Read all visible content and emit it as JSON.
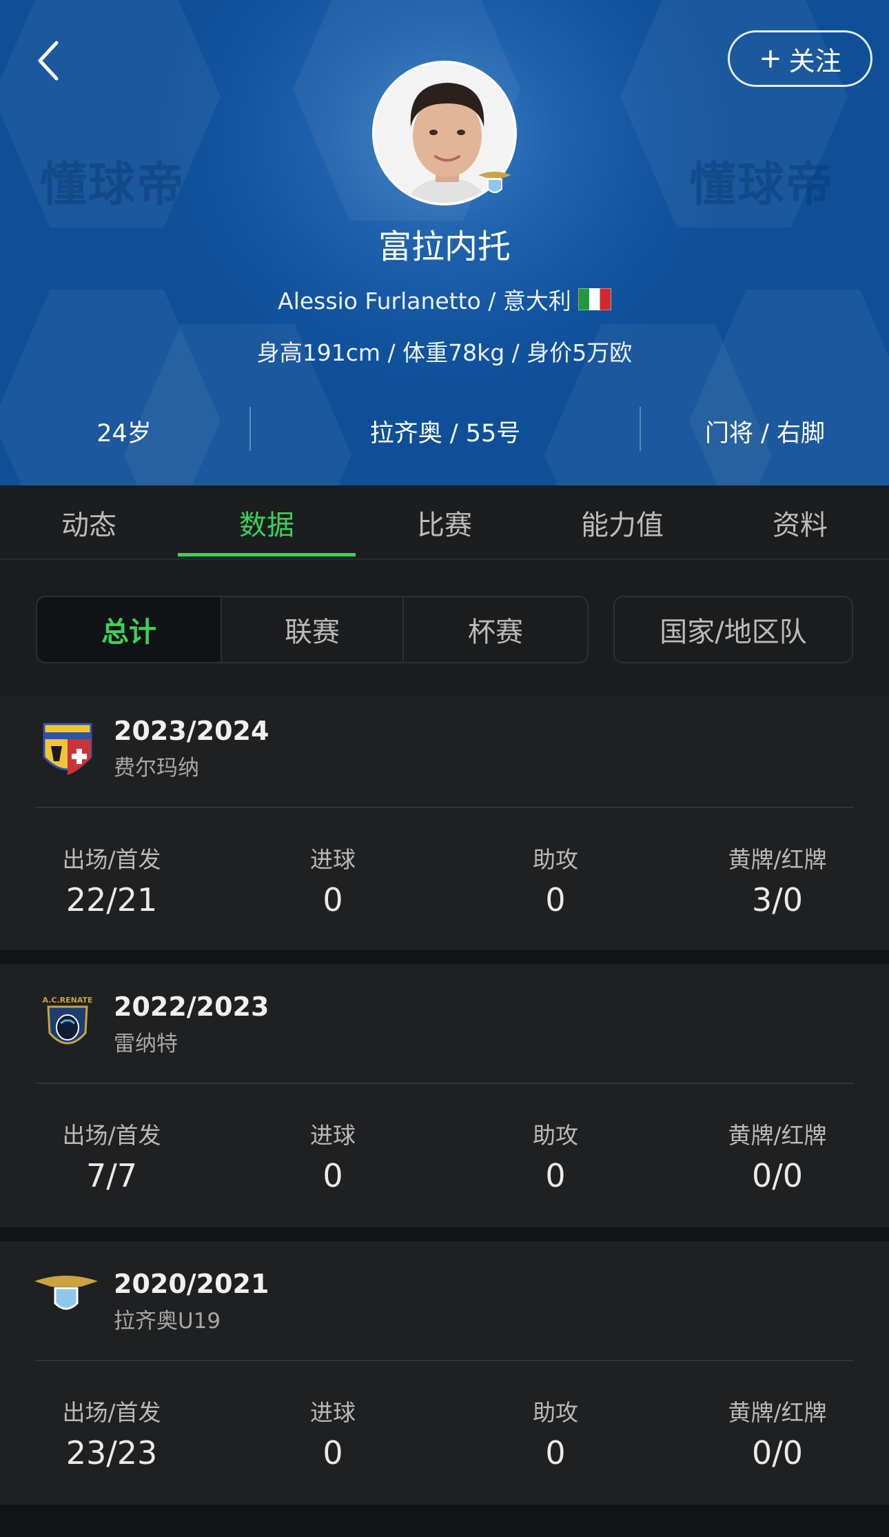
{
  "header": {
    "watermark": "懂球帝",
    "follow_label": "关注",
    "follow_plus": "+",
    "player_name": "富拉内托",
    "player_en_name_nationality": "Alessio Furlanetto / 意大利",
    "player_info": "身高191cm / 体重78kg / 身价5万欧",
    "age": "24岁",
    "club_number": "拉齐奥 / 55号",
    "position_foot": "门将 / 右脚"
  },
  "tabs": [
    "动态",
    "数据",
    "比赛",
    "能力值",
    "资料"
  ],
  "active_tab": 1,
  "filters": [
    "总计",
    "联赛",
    "杯赛",
    "国家/地区队"
  ],
  "active_filter": 0,
  "stat_labels": {
    "apps": "出场/首发",
    "goals": "进球",
    "assists": "助攻",
    "cards": "黄牌/红牌"
  },
  "seasons": [
    {
      "season": "2023/2024",
      "club": "费尔玛纳",
      "apps": "22/21",
      "goals": "0",
      "assists": "0",
      "cards": "3/0"
    },
    {
      "season": "2022/2023",
      "club": "雷纳特",
      "apps": "7/7",
      "goals": "0",
      "assists": "0",
      "cards": "0/0"
    },
    {
      "season": "2020/2021",
      "club": "拉齐奥U19",
      "apps": "23/23",
      "goals": "0",
      "assists": "0",
      "cards": "0/0"
    }
  ],
  "colors": {
    "accent": "#3dd15a",
    "header_blue": "#12549f",
    "background": "#1b1c1e"
  }
}
